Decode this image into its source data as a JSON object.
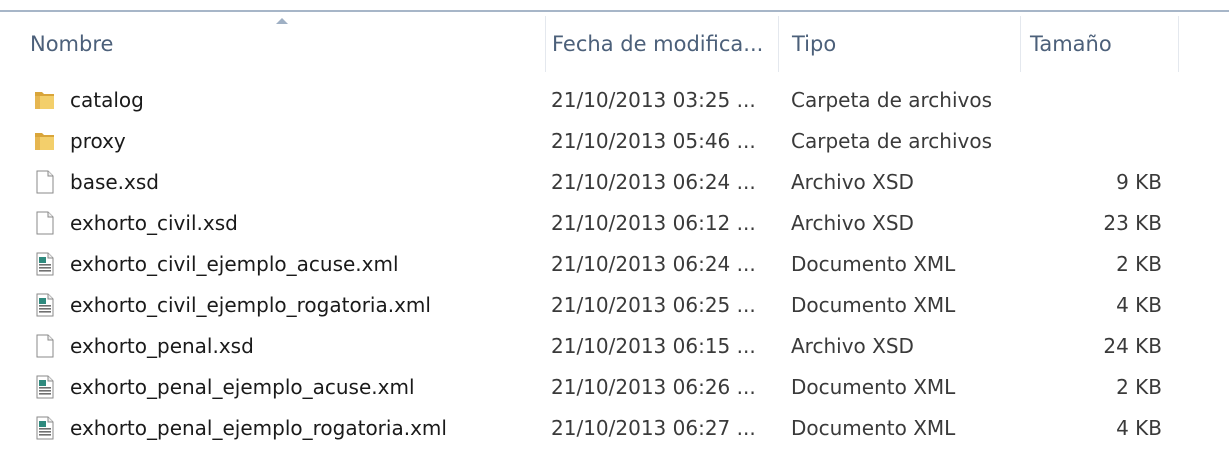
{
  "columns": {
    "name": "Nombre",
    "date": "Fecha de modifica...",
    "type": "Tipo",
    "size": "Tamaño"
  },
  "sort": {
    "column": "name",
    "indicator_icon": "sort-up-arrow-icon"
  },
  "files": [
    {
      "name": "catalog",
      "date": "21/10/2013 03:25 ...",
      "type": "Carpeta de archivos",
      "size": "",
      "icon": "folder-icon"
    },
    {
      "name": "proxy",
      "date": "21/10/2013 05:46 ...",
      "type": "Carpeta de archivos",
      "size": "",
      "icon": "folder-icon"
    },
    {
      "name": "base.xsd",
      "date": "21/10/2013 06:24 ...",
      "type": "Archivo XSD",
      "size": "9 KB",
      "icon": "blank-file-icon"
    },
    {
      "name": "exhorto_civil.xsd",
      "date": "21/10/2013 06:12 ...",
      "type": "Archivo XSD",
      "size": "23 KB",
      "icon": "blank-file-icon"
    },
    {
      "name": "exhorto_civil_ejemplo_acuse.xml",
      "date": "21/10/2013 06:24 ...",
      "type": "Documento XML",
      "size": "2 KB",
      "icon": "xml-file-icon"
    },
    {
      "name": "exhorto_civil_ejemplo_rogatoria.xml",
      "date": "21/10/2013 06:25 ...",
      "type": "Documento XML",
      "size": "4 KB",
      "icon": "xml-file-icon"
    },
    {
      "name": "exhorto_penal.xsd",
      "date": "21/10/2013 06:15 ...",
      "type": "Archivo XSD",
      "size": "24 KB",
      "icon": "blank-file-icon"
    },
    {
      "name": "exhorto_penal_ejemplo_acuse.xml",
      "date": "21/10/2013 06:26 ...",
      "type": "Documento XML",
      "size": "2 KB",
      "icon": "xml-file-icon"
    },
    {
      "name": "exhorto_penal_ejemplo_rogatoria.xml",
      "date": "21/10/2013 06:27 ...",
      "type": "Documento XML",
      "size": "4 KB",
      "icon": "xml-file-icon"
    }
  ],
  "colors": {
    "header_text": "#4c607a",
    "folder": "#e8b84a",
    "xml_accent": "#2f8a7e"
  }
}
